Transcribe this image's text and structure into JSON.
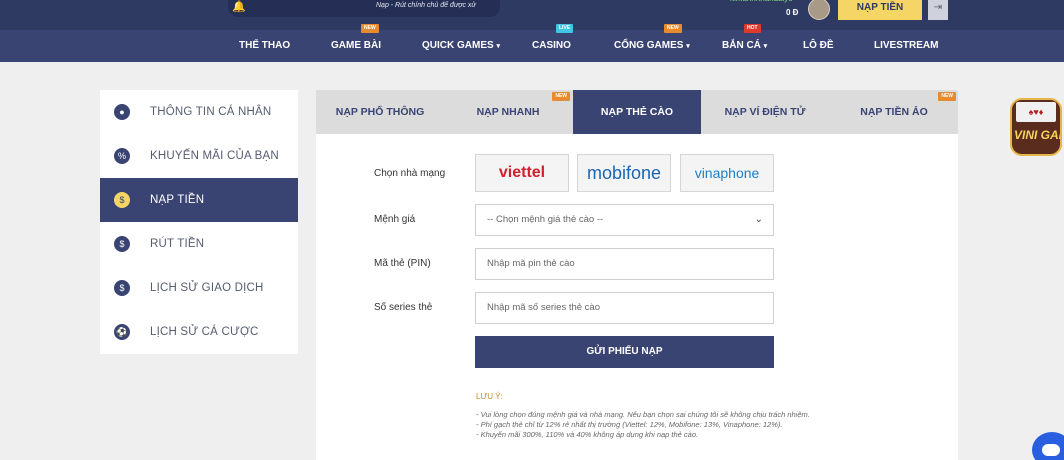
{
  "top": {
    "marquee_text": "Nạp - Rút chính chủ để được xử",
    "username": "kimanhnhandaiyo",
    "balance": "0 Đ",
    "topup_label": "NẠP TIỀN",
    "logout_icon": "logout-icon"
  },
  "nav": {
    "items": [
      {
        "label": "THỂ THAO",
        "tag": ""
      },
      {
        "label": "GAME BÀI",
        "tag": "NEW"
      },
      {
        "label": "QUICK GAMES",
        "tag": "",
        "caret": "▾"
      },
      {
        "label": "CASINO",
        "tag": "LIVE"
      },
      {
        "label": "CỔNG GAMES",
        "tag": "NEW",
        "caret": "▾"
      },
      {
        "label": "BẮN CÁ",
        "tag": "HOT",
        "caret": "▾"
      },
      {
        "label": "LÔ ĐỀ",
        "tag": ""
      },
      {
        "label": "LIVESTREAM",
        "tag": ""
      }
    ]
  },
  "sidebar": {
    "items": [
      {
        "label": "THÔNG TIN CÁ NHÂN",
        "icon": "user-icon"
      },
      {
        "label": "KHUYẾN MÃI CỦA BẠN",
        "icon": "percent-icon"
      },
      {
        "label": "NẠP TIỀN",
        "icon": "deposit-icon",
        "active": true
      },
      {
        "label": "RÚT TIỀN",
        "icon": "withdraw-icon"
      },
      {
        "label": "LỊCH SỬ GIAO DỊCH",
        "icon": "history-icon"
      },
      {
        "label": "LỊCH SỬ CÁ CƯỢC",
        "icon": "ball-icon"
      }
    ]
  },
  "tabs": [
    {
      "label": "NẠP PHỔ THÔNG",
      "tag": ""
    },
    {
      "label": "NẠP NHANH",
      "tag": "NEW"
    },
    {
      "label": "NẠP THẺ CÀO",
      "tag": "",
      "active": true
    },
    {
      "label": "NẠP VÍ ĐIỆN TỬ",
      "tag": ""
    },
    {
      "label": "NẠP TIỀN ẢO",
      "tag": "NEW"
    }
  ],
  "form": {
    "provider_label": "Chọn nhà mạng",
    "providers": [
      {
        "name": "viettel",
        "color": "#d1202e"
      },
      {
        "name": "mobifone",
        "color": "#1a66b3"
      },
      {
        "name": "vinaphone",
        "color": "#1c7fc4"
      }
    ],
    "denomination_label": "Mệnh giá",
    "denomination_value": "-- Chọn mệnh giá thẻ cào --",
    "pin_label": "Mã thẻ (PIN)",
    "pin_placeholder": "Nhập mã pin thẻ cào",
    "serial_label": "Số series thẻ",
    "serial_placeholder": "Nhập mã số series thẻ cào",
    "submit_label": "GỬI PHIẾU NẠP"
  },
  "notes": {
    "title": "LƯU Ý:",
    "lines": [
      "- Vui lòng chọn đúng mệnh giá và nhà mạng. Nếu bạn chọn sai chúng tôi sẽ không chịu trách nhiệm.",
      "- Phí gạch thẻ chỉ từ 12% rẻ nhất thị trường (Viettel: 12%, Mobifone: 13%, Vinaphone: 12%).",
      "- Khuyến mãi 300%, 110% và 40% không áp dụng khi nạp thẻ cào."
    ]
  },
  "badge": {
    "text": "VINI GAME"
  },
  "colors": {
    "primary": "#3a4473",
    "accent": "#f4d566",
    "tag_new": "#e88b2e",
    "tag_live": "#3ec6e4",
    "tag_hot": "#e0382e"
  }
}
